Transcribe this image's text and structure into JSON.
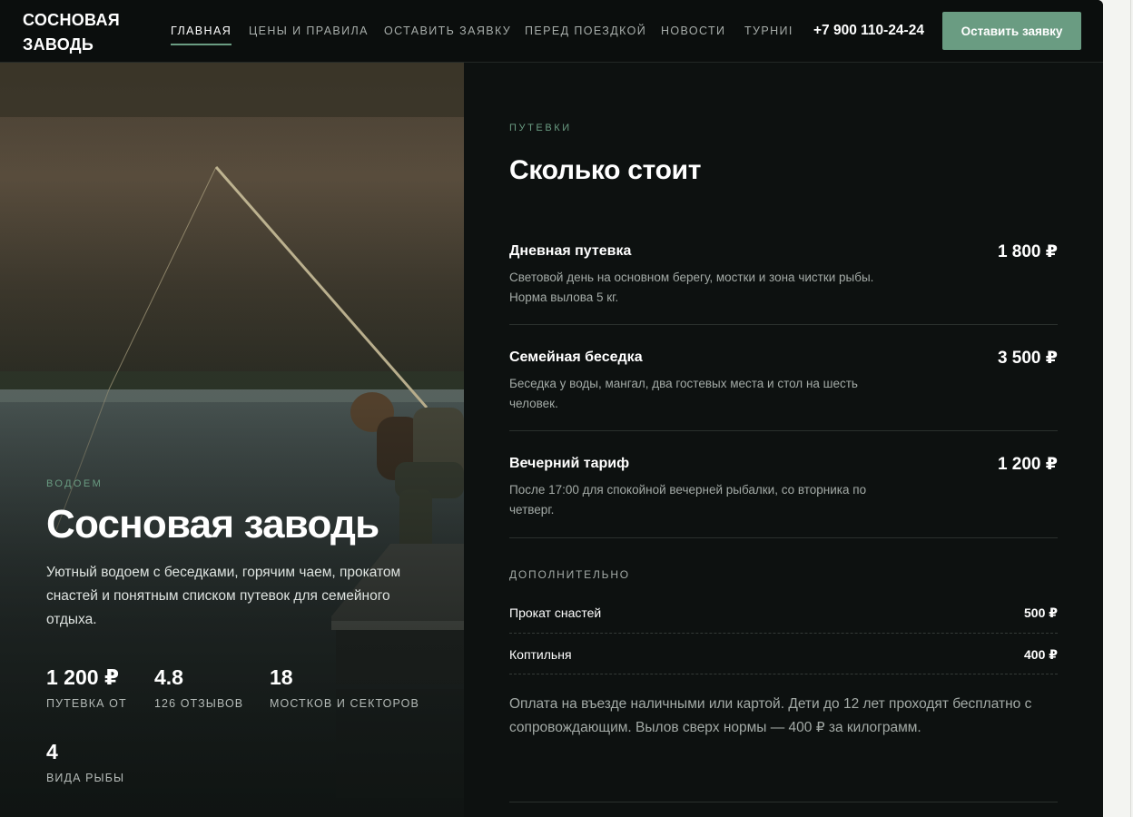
{
  "header": {
    "logo": "СОСНОВАЯ ЗАВОДЬ",
    "nav": [
      {
        "label": "ГЛАВНАЯ",
        "active": true
      },
      {
        "label": "ЦЕНЫ И ПРАВИЛА"
      },
      {
        "label": "ОСТАВИТЬ ЗАЯВКУ"
      },
      {
        "label": "ПЕРЕД ПОЕЗДКОЙ"
      },
      {
        "label": "НОВОСТИ"
      },
      {
        "label": "ТУРНИI"
      }
    ],
    "phone": "+7 900 110-24-24",
    "cta": "Оставить заявку"
  },
  "hero": {
    "eyebrow": "ВОДОЕМ",
    "title": "Сосновая заводь",
    "description": "Уютный водоем с беседками, горячим чаем, прокатом снастей и понятным списком путевок для семейного отдыха.",
    "stats": [
      {
        "value": "1 200 ₽",
        "label": "ПУТЕВКА ОТ"
      },
      {
        "value": "4.8",
        "label": "126 ОТЗЫВОВ"
      },
      {
        "value": "18",
        "label": "МОСТКОВ И СЕКТОРОВ"
      },
      {
        "value": "4",
        "label": "ВИДА РЫБЫ"
      }
    ]
  },
  "pricing": {
    "eyebrow": "ПУТЕВКИ",
    "title": "Сколько стоит",
    "tariffs": [
      {
        "name": "Дневная путевка",
        "price": "1 800 ₽",
        "description": "Световой день на основном берегу, мостки и зона чистки рыбы. Норма вылова 5 кг."
      },
      {
        "name": "Семейная беседка",
        "price": "3 500 ₽",
        "description": "Беседка у воды, мангал, два гостевых места и стол на шесть человек."
      },
      {
        "name": "Вечерний тариф",
        "price": "1 200 ₽",
        "description": "После 17:00 для спокойной вечерней рыбалки, со вторника по четверг."
      }
    ],
    "extras_title": "ДОПОЛНИТЕЛЬНО",
    "extras": [
      {
        "name": "Прокат снастей",
        "price": "500 ₽"
      },
      {
        "name": "Коптильня",
        "price": "400 ₽"
      }
    ],
    "note": "Оплата на въезде наличными или картой. Дети до 12 лет проходят бесплатно с сопровождающим. Вылов сверх нормы — 400 ₽ за килограмм."
  }
}
